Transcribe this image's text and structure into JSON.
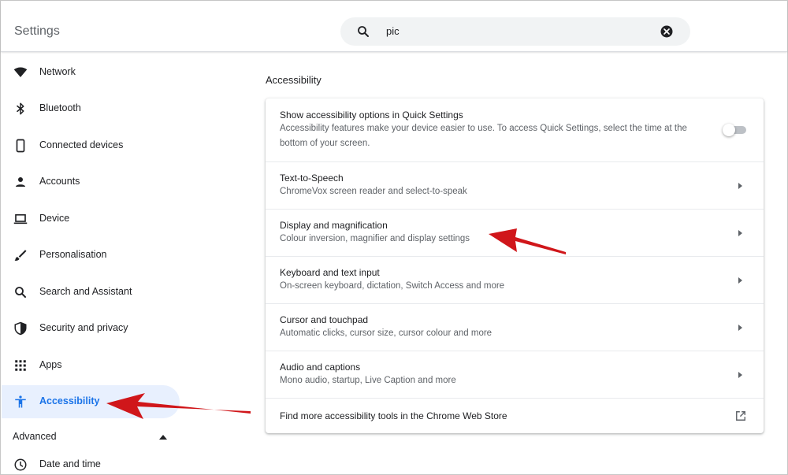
{
  "header": {
    "title": "Settings",
    "search": {
      "value": "pic",
      "icon": "search-icon",
      "clear_icon": "clear-icon"
    }
  },
  "sidebar": {
    "items": [
      {
        "label": "Network",
        "icon": "wifi-icon"
      },
      {
        "label": "Bluetooth",
        "icon": "bluetooth-icon"
      },
      {
        "label": "Connected devices",
        "icon": "phone-icon"
      },
      {
        "label": "Accounts",
        "icon": "person-icon"
      },
      {
        "label": "Device",
        "icon": "laptop-icon"
      },
      {
        "label": "Personalisation",
        "icon": "brush-icon"
      },
      {
        "label": "Search and Assistant",
        "icon": "search-icon"
      },
      {
        "label": "Security and privacy",
        "icon": "shield-icon"
      },
      {
        "label": "Apps",
        "icon": "apps-grid-icon"
      },
      {
        "label": "Accessibility",
        "icon": "accessibility-icon",
        "active": true
      },
      {
        "label": "Date and time",
        "icon": "clock-icon"
      }
    ],
    "advanced_label": "Advanced"
  },
  "main": {
    "section_title": "Accessibility",
    "rows": [
      {
        "title": "Show accessibility options in Quick Settings",
        "subtitle_line1": "Accessibility features make your device easier to use. To access Quick Settings, select the time at the",
        "subtitle_line2": "bottom of your screen.",
        "control": "toggle",
        "toggle_on": false
      },
      {
        "title": "Text-to-Speech",
        "subtitle": "ChromeVox screen reader and select-to-speak",
        "control": "chevron"
      },
      {
        "title": "Display and magnification",
        "subtitle": "Colour inversion, magnifier and display settings",
        "control": "chevron"
      },
      {
        "title": "Keyboard and text input",
        "subtitle": "On-screen keyboard, dictation, Switch Access and more",
        "control": "chevron"
      },
      {
        "title": "Cursor and touchpad",
        "subtitle": "Automatic clicks, cursor size, cursor colour and more",
        "control": "chevron"
      },
      {
        "title": "Audio and captions",
        "subtitle": "Mono audio, startup, Live Caption and more",
        "control": "chevron"
      },
      {
        "title": "Find more accessibility tools in the Chrome Web Store",
        "control": "external-link"
      }
    ]
  },
  "colors": {
    "accent": "#1a73e8",
    "active_bg": "#e8f0fe",
    "annotation_arrow": "#d0161a",
    "text_primary": "#202124",
    "text_secondary": "#5f6368"
  }
}
